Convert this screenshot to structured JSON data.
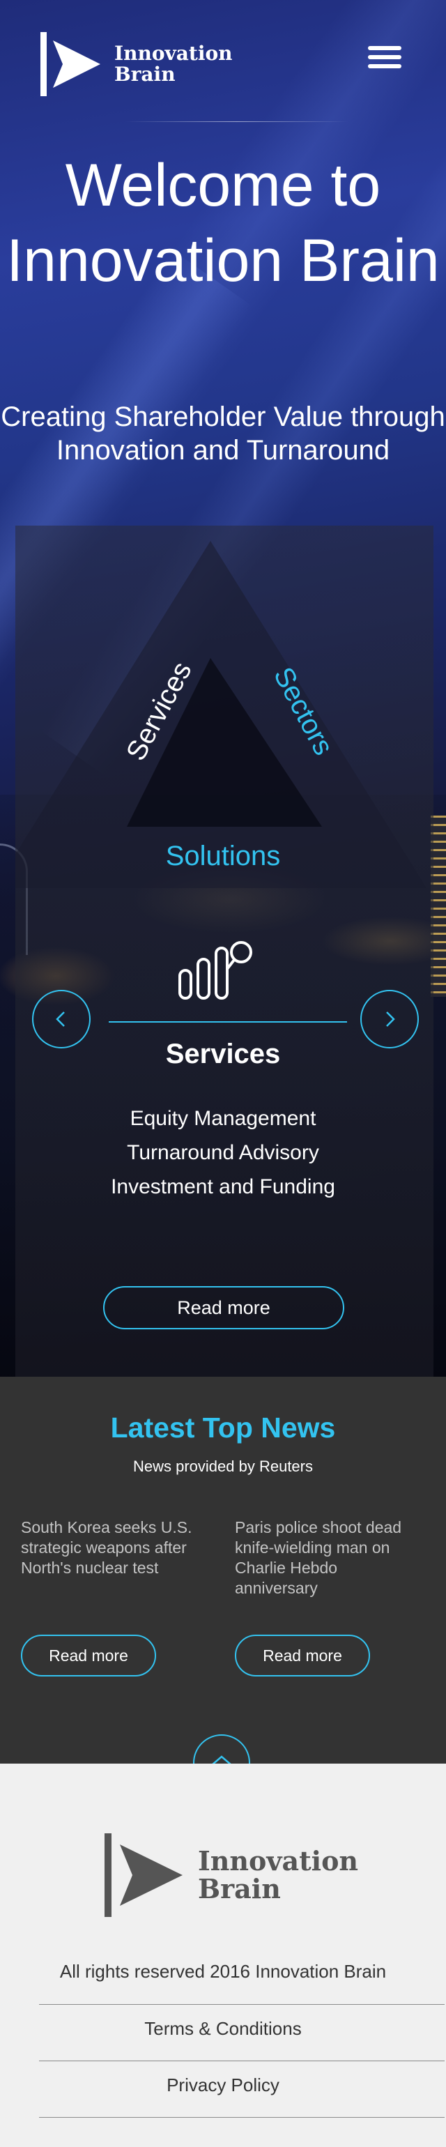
{
  "brand": {
    "name_line1": "Innovation",
    "name_line2": "Brain",
    "accent": "#33c3f0"
  },
  "header": {
    "menu_icon": "hamburger-menu-icon"
  },
  "hero": {
    "title": "Welcome to Innovation Brain",
    "tagline": "Creating Shareholder Value through Innovation and Turnaround"
  },
  "triangle": {
    "left_label": "Services",
    "right_label": "Sectors",
    "bottom_label": "Solutions"
  },
  "slider": {
    "icon": "bar-chart-magnifier-icon",
    "prev_icon": "chevron-left-icon",
    "next_icon": "chevron-right-icon",
    "title": "Services",
    "items": [
      "Equity Management",
      "Turnaround Advisory",
      "Investment and Funding"
    ],
    "read_more": "Read more"
  },
  "news": {
    "title": "Latest Top News",
    "subtitle": "News provided by Reuters",
    "items": [
      {
        "headline": "South Korea seeks U.S. strategic weapons after North's nuclear test",
        "read_more": "Read more"
      },
      {
        "headline": "Paris police shoot dead knife-wielding man on Charlie Hebdo anniversary",
        "read_more": "Read more"
      }
    ]
  },
  "footer": {
    "back_to_top_icon": "chevron-up-icon",
    "copyright": "All rights reserved 2016 Innovation Brain",
    "links": [
      "Terms & Conditions",
      "Privacy Policy"
    ]
  }
}
